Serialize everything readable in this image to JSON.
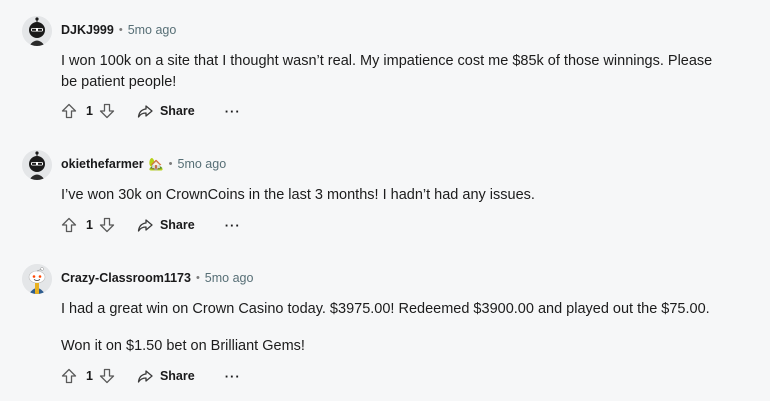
{
  "comments": [
    {
      "username": "DJKJ999",
      "time": "5mo ago",
      "flair": "",
      "body": [
        "I won 100k on a site that I thought wasn’t real. My impatience cost me $85k of those winnings. Please be patient people!"
      ],
      "votes": "1",
      "share_label": "Share",
      "more_label": "···",
      "avatar": "masked-avatar-icon"
    },
    {
      "username": "okiethefarmer",
      "time": "5mo ago",
      "flair": "🏡",
      "body": [
        "I’ve won 30k on CrownCoins in the last 3 months! I hadn’t had any issues."
      ],
      "votes": "1",
      "share_label": "Share",
      "more_label": "···",
      "avatar": "masked-avatar-icon"
    },
    {
      "username": "Crazy-Classroom1173",
      "time": "5mo ago",
      "flair": "",
      "body": [
        "I had a great win on Crown Casino today. $3975.00! Redeemed $3900.00 and played out the $75.00.",
        "Won it on $1.50 bet on Brilliant Gems!"
      ],
      "votes": "1",
      "share_label": "Share",
      "more_label": "···",
      "avatar": "snoo-avatar-icon"
    }
  ],
  "separator": "•",
  "colors": {
    "background": "#f6f7f8",
    "meta": "#576f76",
    "text": "#1c1c1c"
  }
}
